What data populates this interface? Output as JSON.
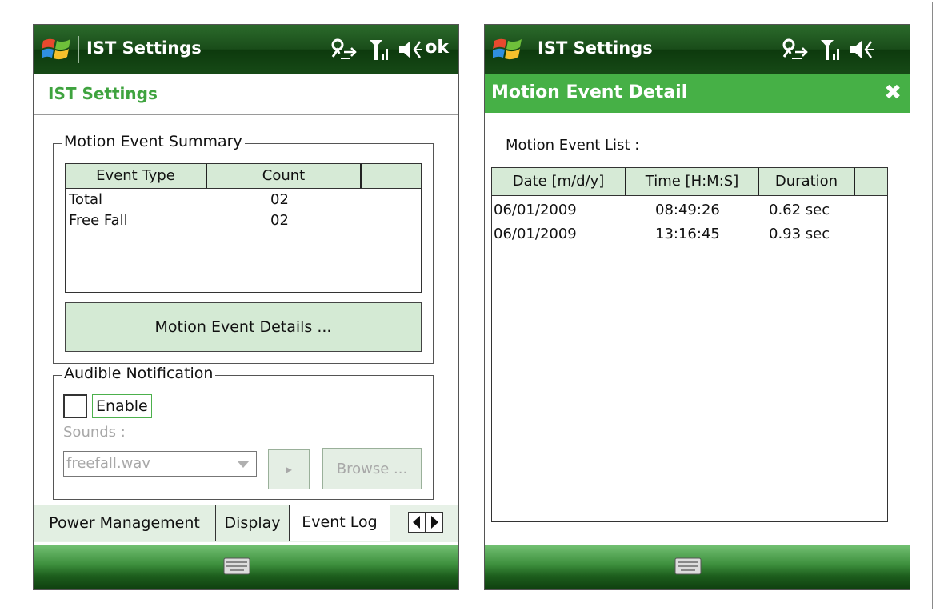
{
  "left": {
    "titlebar": {
      "title": "IST Settings",
      "ok_label": "ok"
    },
    "header": "IST Settings",
    "summary_group": {
      "label": "Motion Event Summary",
      "columns": [
        "Event Type",
        "Count"
      ],
      "rows": [
        {
          "type": "Total",
          "count": "02"
        },
        {
          "type": "Free Fall",
          "count": "02"
        }
      ],
      "details_button": "Motion Event Details ..."
    },
    "audible_group": {
      "label": "Audible Notification",
      "enable_label": "Enable",
      "enable_checked": false,
      "sounds_label": "Sounds :",
      "sound_value": "freefall.wav",
      "play_glyph": "▸",
      "browse_label": "Browse ..."
    },
    "tabs": [
      {
        "label": "Power Management",
        "active": false
      },
      {
        "label": "Display",
        "active": false
      },
      {
        "label": "Event Log",
        "active": true
      }
    ]
  },
  "right": {
    "titlebar": {
      "title": "IST Settings"
    },
    "header": {
      "title": "Motion Event Detail",
      "close_glyph": "✖"
    },
    "list_label": "Motion Event List :",
    "columns": [
      "Date [m/d/y]",
      "Time [H:M:S]",
      "Duration"
    ],
    "rows": [
      {
        "date": "06/01/2009",
        "time": "08:49:26",
        "duration": "0.62 sec"
      },
      {
        "date": "06/01/2009",
        "time": "13:16:45",
        "duration": "0.93 sec"
      }
    ]
  },
  "icons": [
    "windows-logo-icon",
    "connectivity-icon",
    "signal-icon",
    "volume-icon",
    "keyboard-icon"
  ],
  "colors": {
    "accent_green": "#46b046",
    "header_text_green": "#3fa33f",
    "list_header_bg": "#d6ead6"
  }
}
